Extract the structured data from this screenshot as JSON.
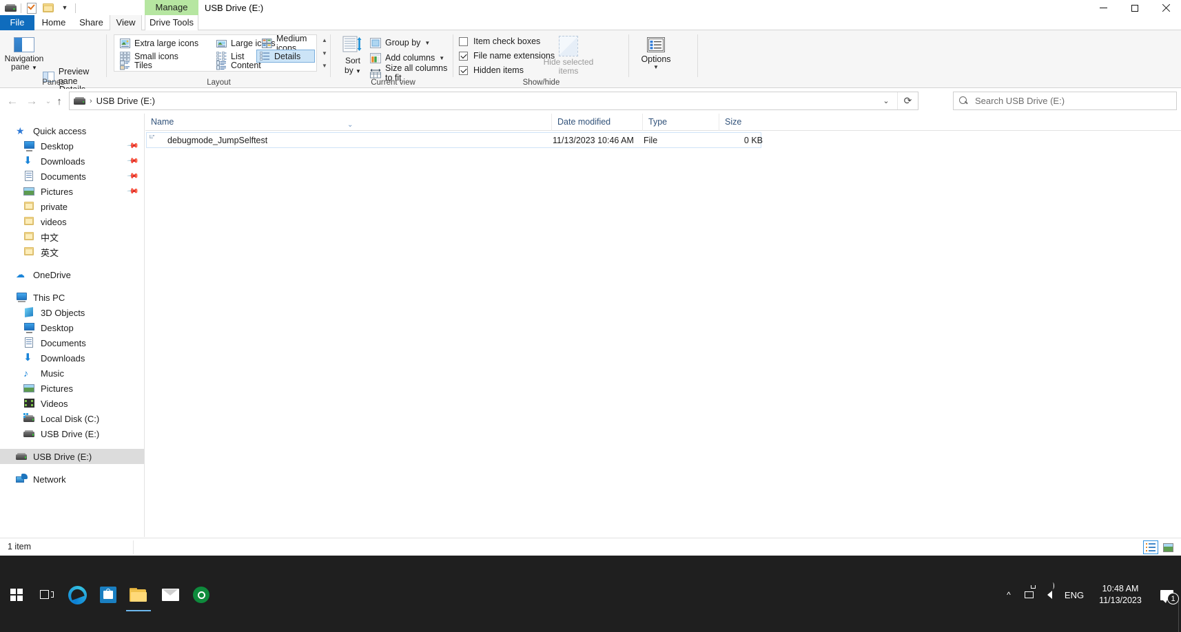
{
  "window": {
    "title": "USB Drive (E:)",
    "contextual_tab_group": "Manage",
    "contextual_tab_label": "Drive Tools",
    "minimize_label": "Minimize",
    "maximize_label": "Maximize",
    "close_label": "Close",
    "help_label": "?"
  },
  "quick_access_toolbar": {
    "items": [
      {
        "name": "drive-icon",
        "label": "USB Drive (E:)"
      },
      {
        "name": "properties-icon",
        "label": "Properties"
      },
      {
        "name": "new-folder-icon",
        "label": "New folder"
      },
      {
        "name": "customize-chevron",
        "label": "▾"
      }
    ]
  },
  "ribbon_tabs": [
    {
      "id": "file",
      "label": "File"
    },
    {
      "id": "home",
      "label": "Home"
    },
    {
      "id": "share",
      "label": "Share"
    },
    {
      "id": "view",
      "label": "View"
    },
    {
      "id": "drive-tools",
      "label": "Drive Tools"
    }
  ],
  "ribbon": {
    "groups": [
      {
        "id": "panes",
        "label": "Panes"
      },
      {
        "id": "layout",
        "label": "Layout"
      },
      {
        "id": "current-view",
        "label": "Current view"
      },
      {
        "id": "show-hide",
        "label": "Show/hide"
      }
    ],
    "panes": {
      "navigation_pane": "Navigation\npane",
      "navigation_pane_line1": "Navigation",
      "navigation_pane_line2": "pane",
      "preview_pane": "Preview pane",
      "details_pane": "Details pane"
    },
    "layout": {
      "items": [
        {
          "label": "Extra large icons",
          "selected": false
        },
        {
          "label": "Large icons",
          "selected": false
        },
        {
          "label": "Medium icons",
          "selected": false
        },
        {
          "label": "Small icons",
          "selected": false
        },
        {
          "label": "List",
          "selected": false
        },
        {
          "label": "Details",
          "selected": true
        },
        {
          "label": "Tiles",
          "selected": false
        },
        {
          "label": "Content",
          "selected": false
        }
      ]
    },
    "current_view": {
      "sort_by_line1": "Sort",
      "sort_by_line2": "by",
      "group_by": "Group by",
      "add_columns": "Add columns",
      "size_all_columns": "Size all columns to fit"
    },
    "show_hide": {
      "item_check_boxes": {
        "label": "Item check boxes",
        "checked": false
      },
      "file_name_extensions": {
        "label": "File name extensions",
        "checked": true
      },
      "hidden_items": {
        "label": "Hidden items",
        "checked": true
      },
      "hide_selected_line1": "Hide selected",
      "hide_selected_line2": "items"
    },
    "options": {
      "label": "Options"
    }
  },
  "address_bar": {
    "back_label": "Back",
    "forward_label": "Forward",
    "recent_label": "Recent locations",
    "up_label": "Up",
    "breadcrumb": "USB Drive (E:)",
    "dropdown_label": "Previous locations",
    "refresh_label": "Refresh"
  },
  "search": {
    "placeholder": "Search USB Drive (E:)"
  },
  "sidebar": {
    "sections": [
      {
        "header": {
          "label": "Quick access",
          "icon": "star-pin-icon"
        },
        "items": [
          {
            "label": "Desktop",
            "icon": "desktop-icon",
            "pinned": true,
            "indent": 2
          },
          {
            "label": "Downloads",
            "icon": "downloads-icon",
            "pinned": true,
            "indent": 2
          },
          {
            "label": "Documents",
            "icon": "documents-icon",
            "pinned": true,
            "indent": 2
          },
          {
            "label": "Pictures",
            "icon": "pictures-icon",
            "pinned": true,
            "indent": 2
          },
          {
            "label": "private",
            "icon": "folder-icon",
            "pinned": false,
            "indent": 2
          },
          {
            "label": "videos",
            "icon": "folder-icon",
            "pinned": false,
            "indent": 2
          },
          {
            "label": "中文",
            "icon": "folder-icon",
            "pinned": false,
            "indent": 2
          },
          {
            "label": "英文",
            "icon": "folder-icon",
            "pinned": false,
            "indent": 2
          }
        ]
      },
      {
        "header": {
          "label": "OneDrive",
          "icon": "onedrive-cloud-icon"
        },
        "items": []
      },
      {
        "header": {
          "label": "This PC",
          "icon": "this-pc-icon"
        },
        "items": [
          {
            "label": "3D Objects",
            "icon": "3d-objects-icon",
            "indent": 2
          },
          {
            "label": "Desktop",
            "icon": "desktop-icon",
            "indent": 2
          },
          {
            "label": "Documents",
            "icon": "documents-icon",
            "indent": 2
          },
          {
            "label": "Downloads",
            "icon": "downloads-icon",
            "indent": 2
          },
          {
            "label": "Music",
            "icon": "music-icon",
            "indent": 2
          },
          {
            "label": "Pictures",
            "icon": "pictures-icon",
            "indent": 2
          },
          {
            "label": "Videos",
            "icon": "videos-icon",
            "indent": 2
          },
          {
            "label": "Local Disk (C:)",
            "icon": "local-disk-icon",
            "indent": 2
          },
          {
            "label": "USB Drive (E:)",
            "icon": "usb-drive-icon",
            "indent": 2
          }
        ]
      },
      {
        "header": {
          "label": "USB Drive (E:)",
          "icon": "usb-drive-icon",
          "selected": true
        },
        "items": []
      },
      {
        "header": {
          "label": "Network",
          "icon": "network-icon"
        },
        "items": []
      }
    ]
  },
  "file_list": {
    "columns": [
      {
        "label": "Name",
        "sorted": true
      },
      {
        "label": "Date modified"
      },
      {
        "label": "Type"
      },
      {
        "label": "Size"
      }
    ],
    "rows": [
      {
        "name": "debugmode_JumpSelftest",
        "date_modified": "11/13/2023 10:46 AM",
        "type": "File",
        "size": "0 KB",
        "icon": "generic-file-icon",
        "selected": true
      }
    ]
  },
  "status_bar": {
    "item_count": "1 item",
    "details_view_label": "Details view",
    "thumbnail_view_label": "Large thumbnails view"
  },
  "taskbar": {
    "buttons": [
      {
        "id": "start",
        "label": "Start",
        "icon": "windows-logo-icon"
      },
      {
        "id": "task-view",
        "label": "Task View",
        "icon": "task-view-icon"
      },
      {
        "id": "edge",
        "label": "Microsoft Edge",
        "icon": "edge-icon"
      },
      {
        "id": "store",
        "label": "Microsoft Store",
        "icon": "store-icon"
      },
      {
        "id": "explorer",
        "label": "File Explorer",
        "icon": "file-explorer-icon",
        "active": true
      },
      {
        "id": "mail",
        "label": "Mail",
        "icon": "mail-icon"
      },
      {
        "id": "recorder",
        "label": "Recorder",
        "icon": "record-icon"
      }
    ],
    "tray": {
      "show_hidden_icons": "^",
      "network_label": "Network",
      "volume_label": "Speakers",
      "language": "ENG",
      "time": "10:48 AM",
      "date": "11/13/2023",
      "notification_count": "1"
    }
  },
  "colors": {
    "accent": "#0f6cbd",
    "contextual_tab": "#b6e6a1",
    "selection": "#cce4f7",
    "nav_selection": "#dcdcdc",
    "taskbar": "#1f1f1f",
    "column_header_text": "#31527a"
  }
}
